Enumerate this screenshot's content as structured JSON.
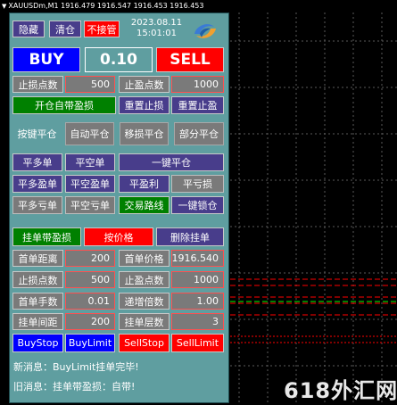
{
  "chart": {
    "symbol_line": "XAUUSDm,M1  1916.479 1916.547 1916.453 1916.453",
    "watermark": "618外汇网"
  },
  "colors": {
    "panel_bg": "#5f9ea0",
    "dark_button": "#483d8b",
    "gray_button": "#7a7a7a",
    "green_button": "#008000",
    "red_button": "#ff0000",
    "blue_button": "#0000ff",
    "value_border": "#ff5050",
    "level_line": "#ff0000",
    "chart_bg": "#000000"
  },
  "header": {
    "hide_label": "隐藏",
    "clear_label": "清仓",
    "no_manage_label": "不接管",
    "date": "2023.08.11",
    "time": "15:01:01",
    "logo_icon": "swirl-logo-icon"
  },
  "trade": {
    "buy_label": "BUY",
    "lot_value": "0.10",
    "sell_label": "SELL"
  },
  "sl_tp": {
    "sl_label": "止损点数",
    "sl_value": "500",
    "tp_label": "止盈点数",
    "tp_value": "1000",
    "auto_sltp_label": "开仓自带盈损",
    "reset_sl_label": "重置止损",
    "reset_tp_label": "重置止盈"
  },
  "tabs": [
    {
      "label": "按键平仓"
    },
    {
      "label": "自动平仓"
    },
    {
      "label": "移损平仓"
    },
    {
      "label": "部分平仓"
    }
  ],
  "close_buttons": {
    "close_buy": "平多单",
    "close_sell": "平空单",
    "close_all": "一键平仓",
    "close_buy_profit": "平多盈单",
    "close_sell_profit": "平空盈单",
    "close_profit": "平盈利",
    "close_loss": "平亏损",
    "close_buy_loss": "平多亏单",
    "close_sell_loss": "平空亏单",
    "trade_route": "交易路线",
    "lock_all": "一键锁仓"
  },
  "pending": {
    "tab_sltp": "挂单带盈损",
    "tab_price": "按价格",
    "tab_delete": "删除挂单",
    "first_distance_label": "首单距离",
    "first_distance_value": "200",
    "first_price_label": "首单价格",
    "first_price_value": "1916.540",
    "sl_label": "止损点数",
    "sl_value": "500",
    "tp_label": "止盈点数",
    "tp_value": "1000",
    "first_lot_label": "首单手数",
    "first_lot_value": "0.01",
    "multiplier_label": "递增倍数",
    "multiplier_value": "1.00",
    "spacing_label": "挂单间距",
    "spacing_value": "200",
    "layers_label": "挂单层数",
    "layers_value": "3",
    "buy_stop": "BuyStop",
    "buy_limit": "BuyLimit",
    "sell_stop": "SellStop",
    "sell_limit": "SellLimit"
  },
  "messages": {
    "new_message": "新消息：BuyLimit挂单完毕!",
    "old_message": "旧消息：挂单带盈损：自带!"
  }
}
